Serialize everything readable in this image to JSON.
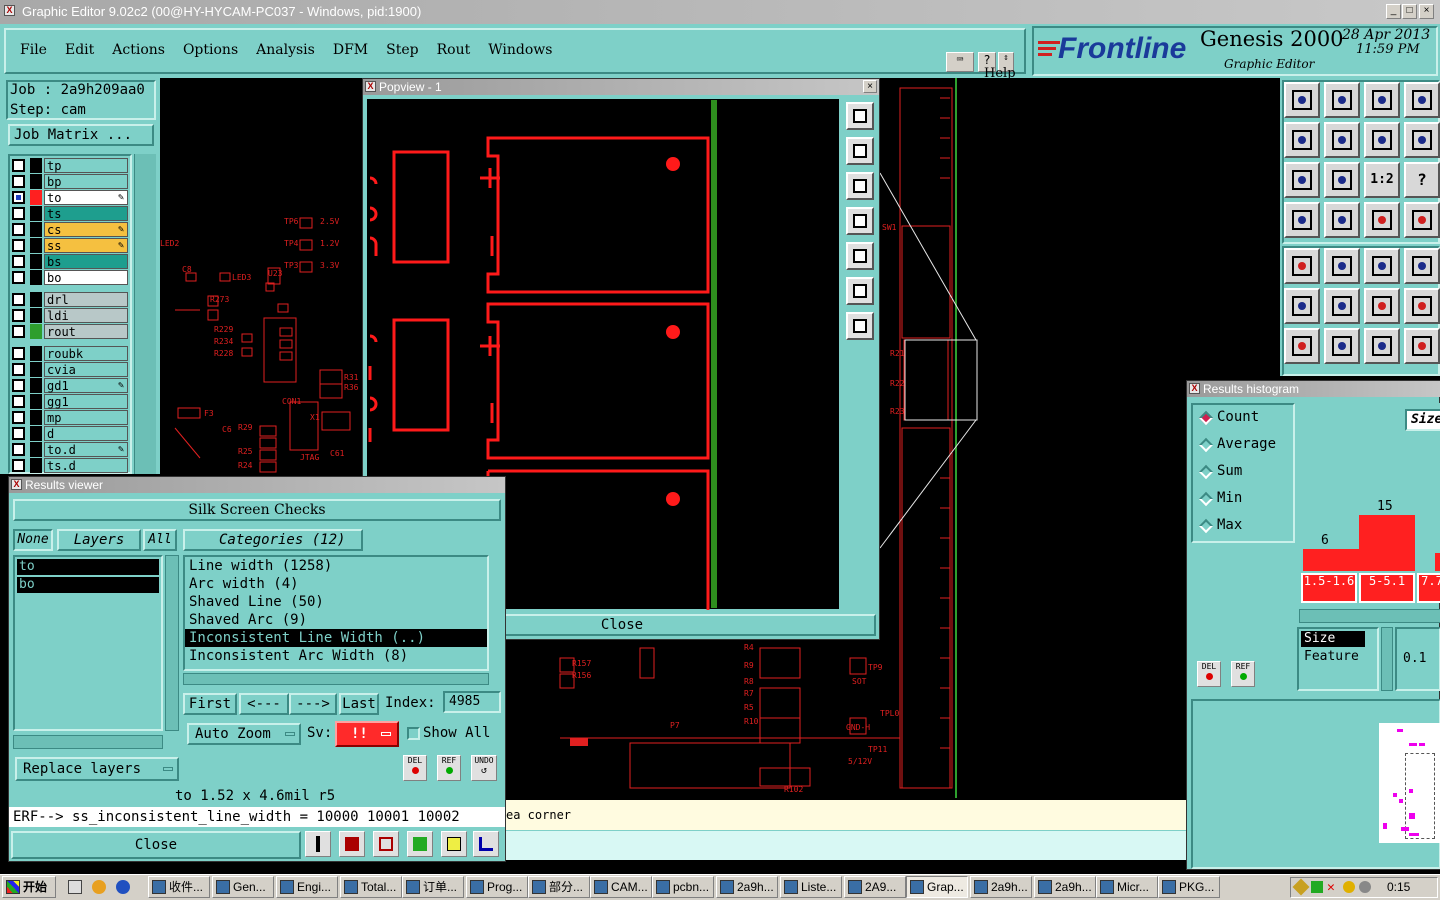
{
  "window": {
    "title": "Graphic Editor 9.02c2 (00@HY-HYCAM-PC037 - Windows, pid:1900)"
  },
  "menu": [
    "File",
    "Edit",
    "Actions",
    "Options",
    "Analysis",
    "DFM",
    "Step",
    "Rout",
    "Windows"
  ],
  "help_label": "Help",
  "brand": {
    "logo": "Frontline",
    "product": "Genesis 2000",
    "subtitle": "Graphic Editor",
    "date": "28 Apr 2013",
    "time": "11:59 PM"
  },
  "job": {
    "job_label": "Job : 2a9h209aa0",
    "step_label": "Step: cam",
    "matrix_button": "Job Matrix ..."
  },
  "layers": [
    {
      "name": "tp",
      "color": "#7ed0c8",
      "marker": false
    },
    {
      "name": "bp",
      "color": "#7ed0c8",
      "marker": false
    },
    {
      "name": "to",
      "color": "#ffffff",
      "marker": true,
      "active": true
    },
    {
      "name": "ts",
      "color": "#1e9e8e",
      "marker": false
    },
    {
      "name": "cs",
      "color": "#f5c040",
      "marker": true
    },
    {
      "name": "ss",
      "color": "#f5c040",
      "marker": true
    },
    {
      "name": "bs",
      "color": "#1e9e8e",
      "marker": false
    },
    {
      "name": "bo",
      "color": "#ffffff",
      "marker": false
    },
    {
      "name": "drl",
      "color": "#b8c8c8",
      "marker": false
    },
    {
      "name": "ldi",
      "color": "#b8c8c8",
      "marker": false
    },
    {
      "name": "rout",
      "color": "#b8c8c8",
      "marker": false,
      "swatch": "#2e9e2e"
    },
    {
      "name": "roubk",
      "color": "#7ed0c8",
      "marker": false
    },
    {
      "name": "cvia",
      "color": "#7ed0c8",
      "marker": false
    },
    {
      "name": "gd1",
      "color": "#7ed0c8",
      "marker": true
    },
    {
      "name": "gg1",
      "color": "#7ed0c8",
      "marker": false
    },
    {
      "name": "mp",
      "color": "#7ed0c8",
      "marker": false
    },
    {
      "name": "d",
      "color": "#7ed0c8",
      "marker": false
    },
    {
      "name": "to.d",
      "color": "#7ed0c8",
      "marker": true
    },
    {
      "name": "ts.d",
      "color": "#7ed0c8",
      "marker": false
    }
  ],
  "results_viewer": {
    "title": "Results viewer",
    "header": "Silk Screen Checks",
    "none_btn": "None",
    "layers_btn": "Layers",
    "all_btn": "All",
    "layer_list": [
      "to",
      "bo"
    ],
    "categories_header": "Categories (12)",
    "categories": [
      "Line width (1258)",
      "Arc width (4)",
      "Shaved Line (50)",
      "Shaved Arc (9)",
      "Inconsistent Line Width (..)",
      "Inconsistent Arc Width (8)"
    ],
    "first_btn": "First",
    "prev_btn": "<---",
    "next_btn": "--->",
    "last_btn": "Last",
    "index_label": "Index:",
    "index_value": "4985",
    "auto_zoom": "Auto Zoom",
    "sv_label": "Sv:",
    "sv_value": "!!",
    "show_all": "Show All",
    "replace_layers": "Replace layers",
    "del_label": "DEL",
    "ref_label": "REF",
    "undo_label": "UNDO",
    "status": "to 1.52 x 4.6mil  r5",
    "erf": "ERF--> ss_inconsistent_line_width = 10000 10001 10002",
    "close": "Close"
  },
  "popview": {
    "title": "Popview - 1",
    "close": "Close"
  },
  "bottom_msg": "ea corner",
  "histogram": {
    "title": "Results histogram",
    "options": [
      "Count",
      "Average",
      "Sum",
      "Min",
      "Max"
    ],
    "selected": "Count",
    "size_label": "Size",
    "bars": [
      {
        "value": "6",
        "label": "1.5-1.6"
      },
      {
        "value": "15",
        "label": "5-5.1"
      },
      {
        "value": "",
        "label": "7.7"
      }
    ],
    "size_btn": "Size",
    "feature_btn": "Feature",
    "value_field": "0.1",
    "del_label": "DEL",
    "ref_label": "REF"
  },
  "toolbox": [
    "1:2",
    "?"
  ],
  "taskbar": {
    "start": "开始",
    "items": [
      "收件...",
      "Gen...",
      "Engi...",
      "Total...",
      "订单...",
      "Prog...",
      "部分...",
      "CAM...",
      "pcbn...",
      "2a9h...",
      "Liste...",
      "2A9...",
      "Grap...",
      "2a9h...",
      "2a9h...",
      "Micr...",
      "PKG..."
    ],
    "clock": "0:15"
  },
  "pcb_labels": [
    "TP6",
    "2.5V",
    "TP4",
    "1.2V",
    "TP3",
    "3.3V",
    "LED2",
    "LED3",
    "U23",
    "C8",
    "R273",
    "R229",
    "R234",
    "R228",
    "R31",
    "R36",
    "R29",
    "R25",
    "R24",
    "C6",
    "X1",
    "C61",
    "JTAG",
    "CON1",
    "P7",
    "R102",
    "TP11",
    "5/12V",
    "TPL0",
    "GND-H",
    "SOT",
    "TP9",
    "R157",
    "R156",
    "R4",
    "R9",
    "R8",
    "R7",
    "R5",
    "R10",
    "R21",
    "R22",
    "R23",
    "SW1",
    "F3"
  ]
}
